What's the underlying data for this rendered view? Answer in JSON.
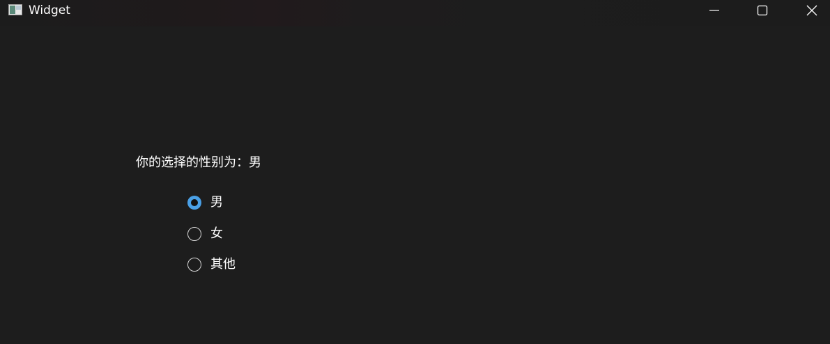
{
  "window": {
    "title": "Widget"
  },
  "result": {
    "text": "你的选择的性别为：男"
  },
  "options": [
    {
      "label": "男",
      "checked": true
    },
    {
      "label": "女",
      "checked": false
    },
    {
      "label": "其他",
      "checked": false
    }
  ],
  "colors": {
    "background": "#1d1d1d",
    "accent": "#4aa0e6",
    "text": "#ffffff"
  }
}
